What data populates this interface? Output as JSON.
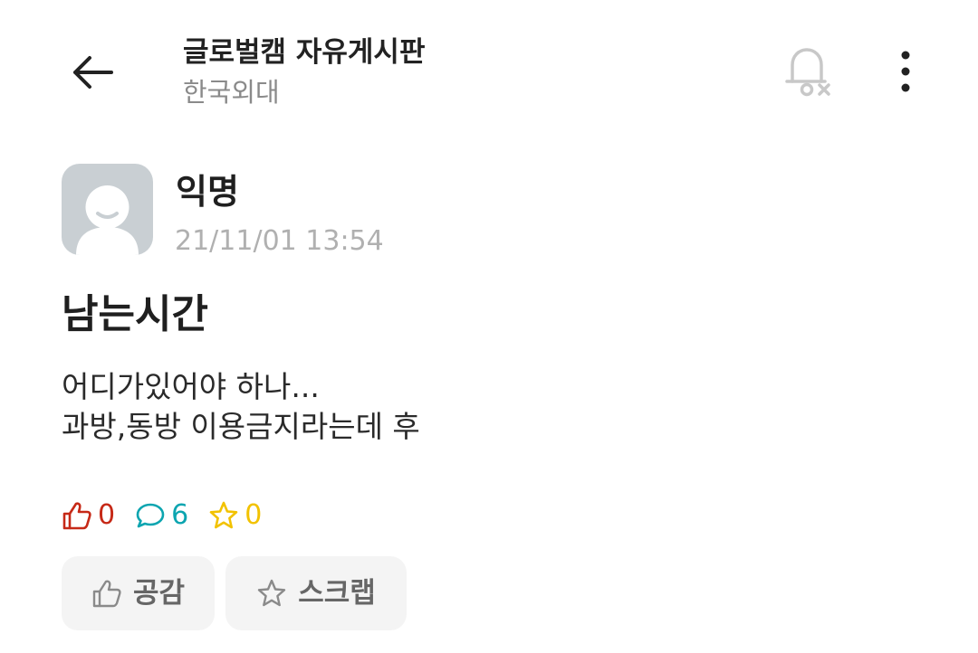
{
  "header": {
    "board_title": "글로벌캠 자유게시판",
    "school": "한국외대",
    "icons": {
      "back": "arrow-left-icon",
      "notification": "bell-off-icon",
      "more": "more-vertical-icon"
    }
  },
  "post": {
    "author": "익명",
    "date": "21/11/01 13:54",
    "title": "남는시간",
    "body_lines": [
      "어디가있어야 하나...",
      "과방,동방 이용금지라는데 후"
    ]
  },
  "stats": {
    "likes": "0",
    "comments": "6",
    "scraps": "0"
  },
  "actions": {
    "like_label": "공감",
    "scrap_label": "스크랩"
  },
  "colors": {
    "like": "#c62917",
    "comment": "#0ca5b0",
    "scrap": "#f2c200",
    "avatar_bg": "#c9cfd3"
  }
}
